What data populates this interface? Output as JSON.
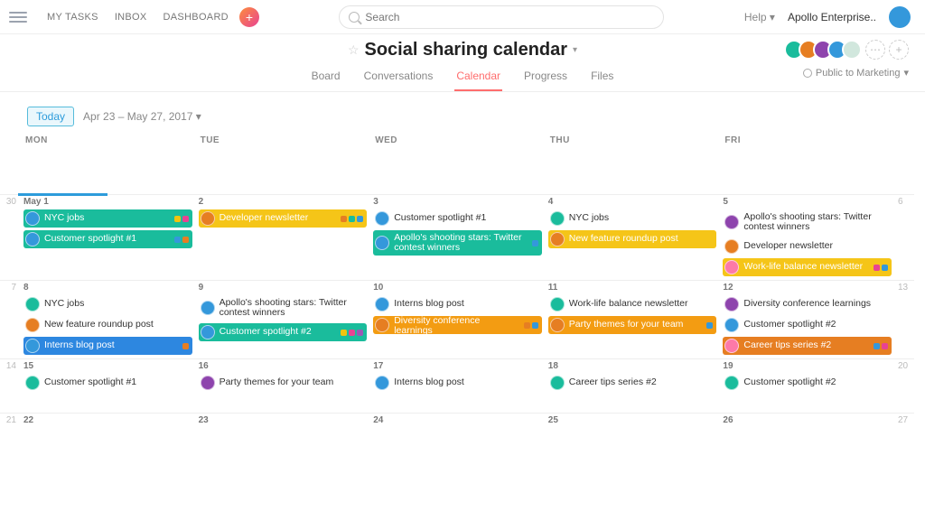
{
  "topbar": {
    "links": [
      "MY TASKS",
      "INBOX",
      "DASHBOARD"
    ],
    "search_placeholder": "Search",
    "help_label": "Help",
    "org_name": "Apollo Enterprise.."
  },
  "project": {
    "title": "Social sharing calendar",
    "tabs": [
      "Board",
      "Conversations",
      "Calendar",
      "Progress",
      "Files"
    ],
    "active_tab": "Calendar",
    "share_label": "Public to Marketing"
  },
  "calendar": {
    "today_label": "Today",
    "date_range": "Apr 23 – May 27, 2017",
    "days_of_week": [
      "MON",
      "TUE",
      "WED",
      "THU",
      "FRI"
    ],
    "weeks": [
      {
        "left_gutter": "",
        "right_gutter": "",
        "cells": [
          {
            "label": "MON",
            "tasks": []
          },
          {
            "label": "TUE",
            "tasks": []
          },
          {
            "label": "WED",
            "tasks": []
          },
          {
            "label": "THU",
            "tasks": []
          },
          {
            "label": "FRI",
            "tasks": []
          }
        ]
      },
      {
        "left_gutter": "30",
        "right_gutter": "6",
        "cells": [
          {
            "label": "May 1",
            "today": true,
            "tasks": [
              {
                "text": "NYC jobs",
                "bg": "teal",
                "av": "blue",
                "tags": [
                  "yellow",
                  "pink"
                ]
              },
              {
                "text": "Customer spotlight #1",
                "bg": "teal",
                "av": "blue",
                "tags": [
                  "blue",
                  "orange"
                ]
              }
            ]
          },
          {
            "label": "2",
            "tasks": [
              {
                "text": "Developer newsletter",
                "bg": "yellow",
                "av": "orange",
                "tags": [
                  "orange",
                  "teal",
                  "blue"
                ]
              }
            ]
          },
          {
            "label": "3",
            "tasks": [
              {
                "text": "Customer spotlight #1",
                "bg": "none",
                "av": "blue"
              },
              {
                "text": "Apollo's shooting stars: Twitter contest winners",
                "bg": "teal",
                "av": "blue",
                "tags": [
                  "blue"
                ],
                "multiline": true
              }
            ]
          },
          {
            "label": "4",
            "tasks": [
              {
                "text": "NYC jobs",
                "bg": "none",
                "av": "teal"
              },
              {
                "text": "New feature roundup post",
                "bg": "yellow",
                "av": "orange"
              }
            ]
          },
          {
            "label": "5",
            "tasks": [
              {
                "text": "Apollo's shooting stars: Twitter contest winners",
                "bg": "none",
                "av": "purple",
                "multiline": true
              },
              {
                "text": "Developer newsletter",
                "bg": "none",
                "av": "orange"
              },
              {
                "text": "Work-life balance newsletter",
                "bg": "yellow",
                "av": "pink",
                "tags": [
                  "pink",
                  "blue"
                ]
              }
            ]
          }
        ]
      },
      {
        "left_gutter": "7",
        "right_gutter": "13",
        "cells": [
          {
            "label": "8",
            "tasks": [
              {
                "text": "NYC jobs",
                "bg": "none",
                "av": "teal"
              },
              {
                "text": "New feature roundup post",
                "bg": "none",
                "av": "orange"
              },
              {
                "text": "Interns blog post",
                "bg": "blue",
                "av": "blue",
                "tags": [
                  "orange"
                ]
              }
            ]
          },
          {
            "label": "9",
            "tasks": [
              {
                "text": "Apollo's shooting stars: Twitter contest winners",
                "bg": "none",
                "av": "blue",
                "multiline": true
              },
              {
                "text": "Customer spotlight #2",
                "bg": "teal",
                "av": "blue",
                "tags": [
                  "yellow",
                  "pink",
                  "purple"
                ]
              }
            ]
          },
          {
            "label": "10",
            "tasks": [
              {
                "text": "Interns blog post",
                "bg": "none",
                "av": "blue"
              },
              {
                "text": "Diversity conference learnings",
                "bg": "orange",
                "av": "orange",
                "tags": [
                  "orange",
                  "blue"
                ]
              }
            ]
          },
          {
            "label": "11",
            "tasks": [
              {
                "text": "Work-life balance newsletter",
                "bg": "none",
                "av": "teal"
              },
              {
                "text": "Party themes for your team",
                "bg": "orange",
                "av": "orange",
                "tags": [
                  "blue"
                ]
              }
            ]
          },
          {
            "label": "12",
            "tasks": [
              {
                "text": "Diversity conference learnings",
                "bg": "none",
                "av": "purple"
              },
              {
                "text": "Customer spotlight #2",
                "bg": "none",
                "av": "blue"
              },
              {
                "text": "Career tips series #2",
                "bg": "orange2",
                "av": "pink",
                "tags": [
                  "blue",
                  "pink"
                ]
              }
            ]
          }
        ]
      },
      {
        "left_gutter": "14",
        "right_gutter": "20",
        "cells": [
          {
            "label": "15",
            "tasks": [
              {
                "text": "Customer spotlight #1",
                "bg": "none",
                "av": "teal"
              }
            ]
          },
          {
            "label": "16",
            "tasks": [
              {
                "text": "Party themes for your team",
                "bg": "none",
                "av": "purple"
              }
            ]
          },
          {
            "label": "17",
            "tasks": [
              {
                "text": "Interns blog post",
                "bg": "none",
                "av": "blue"
              }
            ]
          },
          {
            "label": "18",
            "tasks": [
              {
                "text": "Career tips series #2",
                "bg": "none",
                "av": "teal"
              }
            ]
          },
          {
            "label": "19",
            "tasks": [
              {
                "text": "Customer spotlight #2",
                "bg": "none",
                "av": "teal"
              }
            ]
          }
        ]
      },
      {
        "left_gutter": "21",
        "right_gutter": "27",
        "cells": [
          {
            "label": "22",
            "tasks": []
          },
          {
            "label": "23",
            "tasks": []
          },
          {
            "label": "24",
            "tasks": []
          },
          {
            "label": "25",
            "tasks": []
          },
          {
            "label": "26",
            "tasks": []
          }
        ]
      }
    ]
  }
}
